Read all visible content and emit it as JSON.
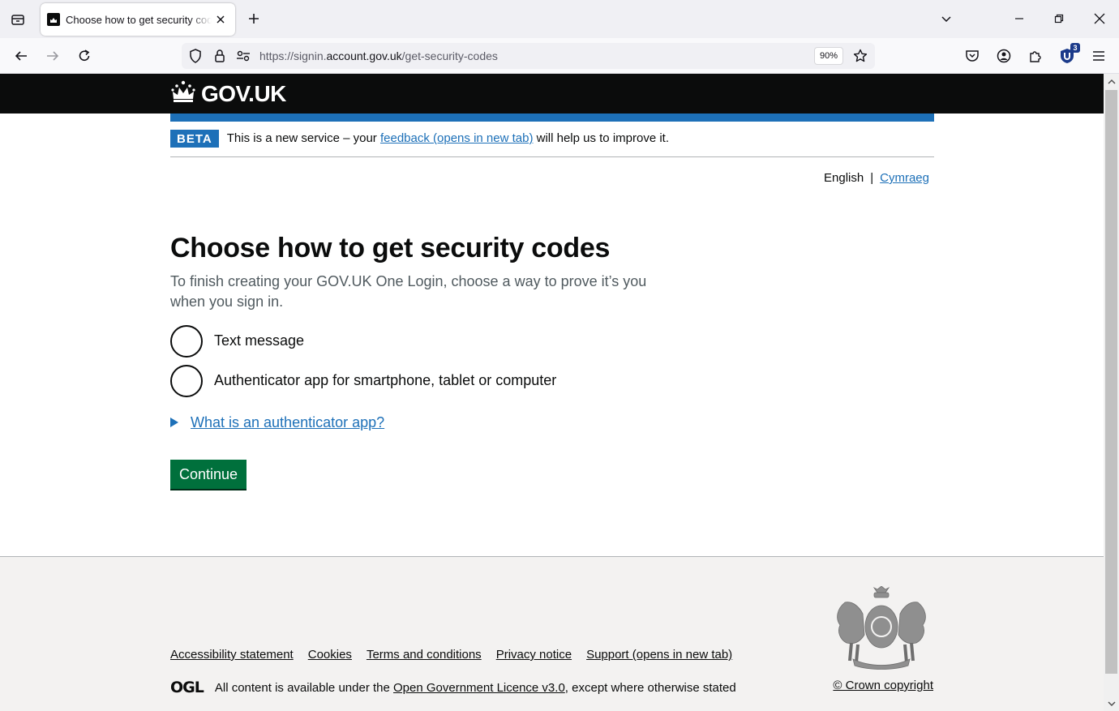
{
  "browser": {
    "tab_title": "Choose how to get security codes",
    "url_prefix": "https://signin.",
    "url_host": "account.gov.uk",
    "url_path": "/get-security-codes",
    "zoom": "90%",
    "extension_badge": "3"
  },
  "header": {
    "logo_text": "GOV.UK"
  },
  "phase_banner": {
    "tag": "BETA",
    "text_before": "This is a new service – your ",
    "link": "feedback (opens in new tab)",
    "text_after": " will help us to improve it."
  },
  "language": {
    "current": "English",
    "separator": "|",
    "other": "Cymraeg"
  },
  "main": {
    "title": "Choose how to get security codes",
    "hint": "To finish creating your GOV.UK One Login, choose a way to prove it’s you when you sign in.",
    "options": [
      {
        "label": "Text message",
        "selected": false
      },
      {
        "label": "Authenticator app for smartphone, tablet or computer",
        "selected": false
      }
    ],
    "details_summary": "What is an authenticator app?",
    "continue_label": "Continue"
  },
  "footer": {
    "links": [
      "Accessibility statement",
      "Cookies",
      "Terms and conditions",
      "Privacy notice",
      "Support (opens in new tab)"
    ],
    "ogl_logo": "OGL",
    "licence_before": "All content is available under the ",
    "licence_link": "Open Government Licence v3.0",
    "licence_after": ", except where otherwise stated",
    "copyright": "© Crown copyright"
  },
  "colors": {
    "govuk_black": "#0b0c0c",
    "govuk_blue": "#1d70b8",
    "govuk_green": "#00703c",
    "footer_bg": "#f3f2f1"
  }
}
